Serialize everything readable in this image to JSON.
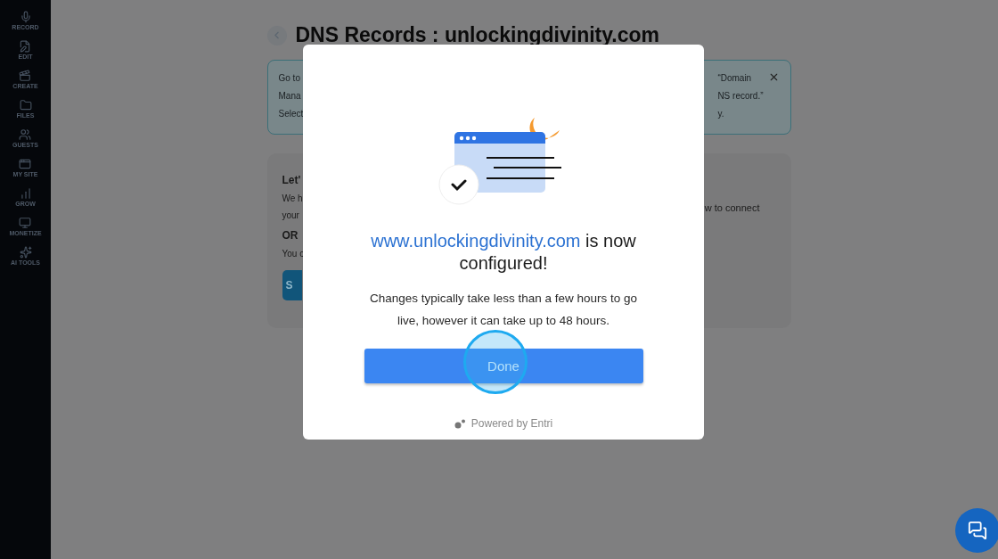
{
  "sidebar": {
    "items": [
      {
        "label": "RECORD",
        "kind": "mic"
      },
      {
        "label": "EDIT",
        "kind": "edit"
      },
      {
        "label": "CREATE",
        "kind": "create"
      },
      {
        "label": "FILES",
        "kind": "files"
      },
      {
        "label": "GUESTS",
        "kind": "guests"
      },
      {
        "label": "MY SITE",
        "kind": "site"
      },
      {
        "label": "GROW",
        "kind": "grow"
      },
      {
        "label": "MONETIZE",
        "kind": "monetize"
      },
      {
        "label": "AI TOOLS",
        "kind": "ai"
      }
    ]
  },
  "page": {
    "title": "DNS Records : unlockingdivinity.com",
    "banner": {
      "left_lines": [
        "Go to",
        "Mana",
        "Select"
      ],
      "right_lines": [
        "“Domain",
        "NS record.”",
        "y."
      ]
    },
    "card": {
      "left_lines": [
        {
          "text": "Let'",
          "kind": "heading"
        },
        {
          "text": "We h",
          "kind": "body"
        },
        {
          "text": "your",
          "kind": "body"
        },
        {
          "text": "OR",
          "kind": "heading"
        },
        {
          "text": "You c",
          "kind": "body"
        }
      ],
      "button": "S",
      "right_lines": [
        "w to connect"
      ]
    }
  },
  "modal": {
    "domain": "www.unlockingdivinity.com",
    "title_rest": "is now configured!",
    "message": "Changes typically take less than a few hours to go live, however it can take up to 48 hours.",
    "button": "Done",
    "footer": "Powered by Entri"
  }
}
